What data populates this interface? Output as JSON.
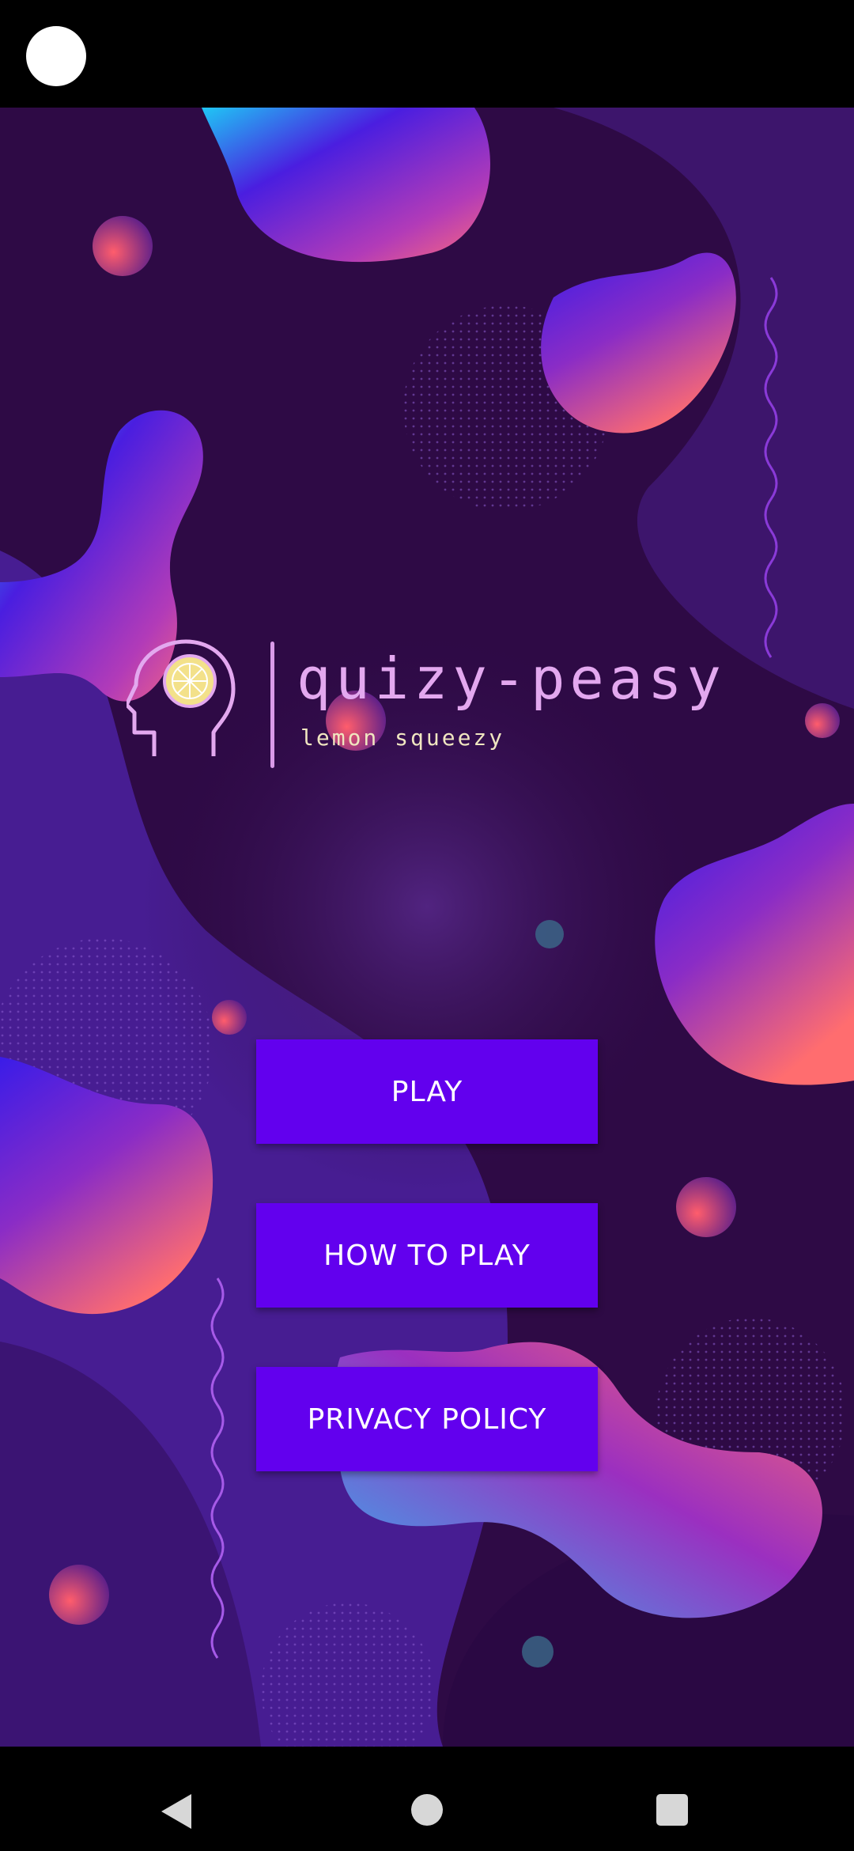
{
  "app": {
    "name": "quizy-peasy",
    "tagline": "lemon squeezy"
  },
  "menu": {
    "play_label": "PLAY",
    "how_to_play_label": "HOW TO PLAY",
    "privacy_policy_label": "PRIVACY POLICY"
  },
  "colors": {
    "button": "#6200ee",
    "background": "#2e0a45",
    "logo": "#e3a8ef"
  },
  "icons": {
    "logo": "head-with-lemon-icon",
    "nav_back": "back-triangle-icon",
    "nav_home": "home-circle-icon",
    "nav_recent": "recent-apps-square-icon"
  }
}
